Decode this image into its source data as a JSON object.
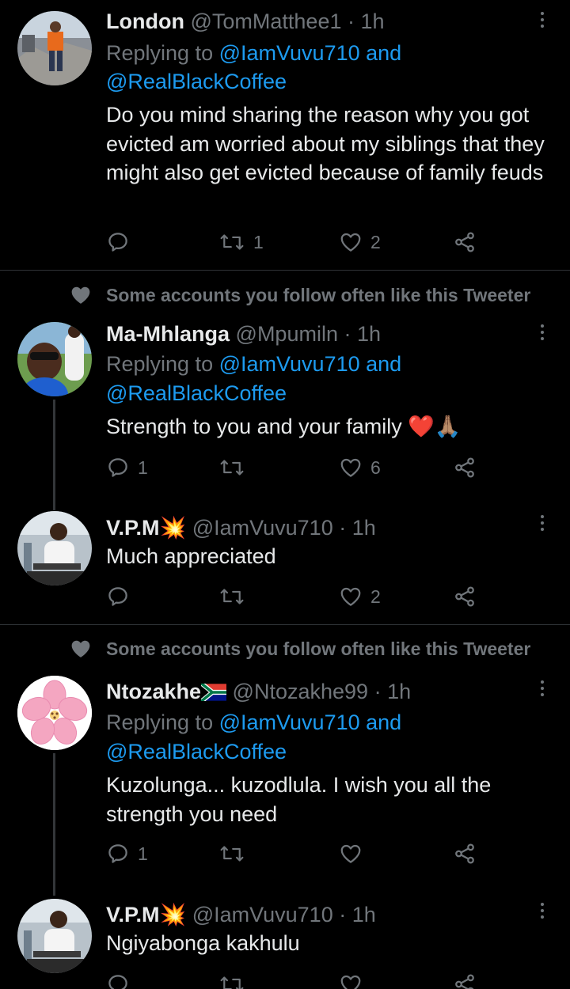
{
  "replying_to_label": "Replying to",
  "social_context": "Some accounts you follow often like this Tweeter",
  "tweets": [
    {
      "name": "London",
      "handle": "@TomMatthee1",
      "dot": "·",
      "time": "1h",
      "reply_mentions": "@IamVuvu710 and",
      "reply_mentions_2": "@RealBlackCoffee",
      "text": "Do you mind sharing the reason why you got evicted am worried about my siblings that they might also get evicted because of family feuds",
      "replies": "",
      "retweets": "1",
      "likes": "2"
    },
    {
      "name": "Ma-Mhlanga",
      "handle": "@Mpumiln",
      "dot": "·",
      "time": "1h",
      "reply_mentions": "@IamVuvu710 and",
      "reply_mentions_2": "@RealBlackCoffee",
      "text": "Strength to you and your family",
      "emoji": "❤️🙏🏽",
      "replies": "1",
      "retweets": "",
      "likes": "6"
    },
    {
      "name": "V.P.M",
      "name_emoji": "💥",
      "handle": "@IamVuvu710",
      "dot": "·",
      "time": "1h",
      "text": "Much appreciated",
      "replies": "",
      "retweets": "",
      "likes": "2"
    },
    {
      "name": "Ntozakhe",
      "handle": "@Ntozakhe99",
      "dot": "·",
      "time": "1h",
      "reply_mentions": "@IamVuvu710 and",
      "reply_mentions_2": "@RealBlackCoffee",
      "text": "Kuzolunga... kuzodlula. I wish you all the strength you need",
      "replies": "1",
      "retweets": "",
      "likes": ""
    },
    {
      "name": "V.P.M",
      "name_emoji": "💥",
      "handle": "@IamVuvu710",
      "dot": "·",
      "time": "1h",
      "text": "Ngiyabonga kakhulu",
      "replies": "",
      "retweets": "",
      "likes": ""
    }
  ],
  "icons": {
    "reply": "reply-icon",
    "retweet": "retweet-icon",
    "like": "heart-icon",
    "share": "share-icon",
    "more": "more-icon"
  },
  "colors": {
    "background": "#000000",
    "text": "#e7e9ea",
    "secondary": "#71767b",
    "link": "#1d9bf0",
    "divider": "#2f3336"
  }
}
